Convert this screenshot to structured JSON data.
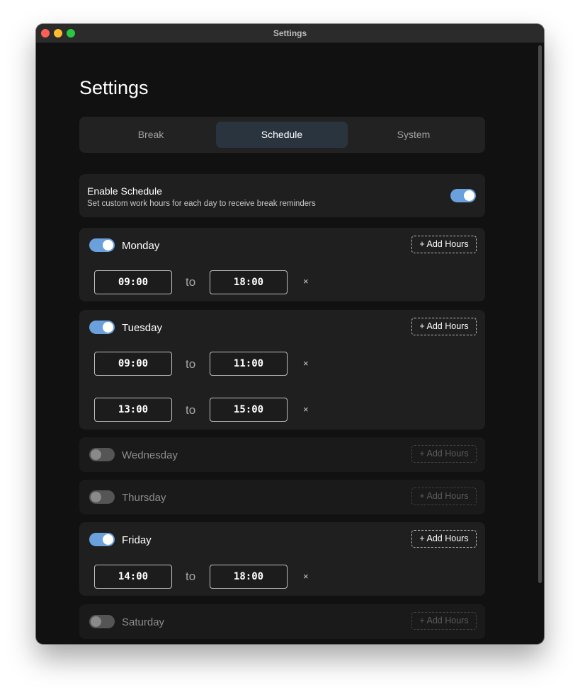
{
  "window": {
    "title": "Settings"
  },
  "page": {
    "title": "Settings"
  },
  "tabs": [
    {
      "label": "Break"
    },
    {
      "label": "Schedule"
    },
    {
      "label": "System"
    }
  ],
  "enable_schedule": {
    "title": "Enable Schedule",
    "description": "Set custom work hours for each day to receive break reminders",
    "enabled": true
  },
  "add_hours_label": "+ Add Hours",
  "to_label": "to",
  "remove_symbol": "×",
  "days": [
    {
      "name": "Monday",
      "enabled": true,
      "ranges": [
        {
          "start": "09:00",
          "end": "18:00"
        }
      ]
    },
    {
      "name": "Tuesday",
      "enabled": true,
      "ranges": [
        {
          "start": "09:00",
          "end": "11:00"
        },
        {
          "start": "13:00",
          "end": "15:00"
        }
      ]
    },
    {
      "name": "Wednesday",
      "enabled": false,
      "ranges": []
    },
    {
      "name": "Thursday",
      "enabled": false,
      "ranges": []
    },
    {
      "name": "Friday",
      "enabled": true,
      "ranges": [
        {
          "start": "14:00",
          "end": "18:00"
        }
      ]
    },
    {
      "name": "Saturday",
      "enabled": false,
      "ranges": []
    }
  ],
  "colors": {
    "accent": "#6aa1dd",
    "background": "#111111",
    "card": "#1f1f1f",
    "active_tab": "#2a343f"
  }
}
